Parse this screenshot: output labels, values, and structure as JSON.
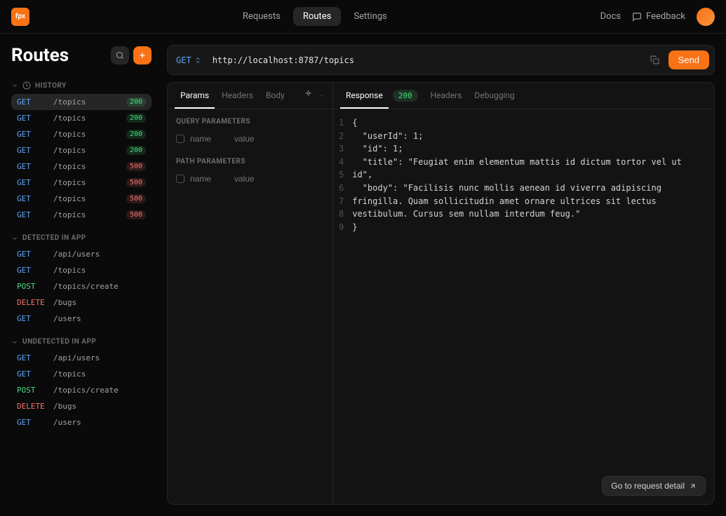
{
  "logo_text": "fpx",
  "nav": {
    "requests": "Requests",
    "routes": "Routes",
    "settings": "Settings",
    "docs": "Docs",
    "feedback": "Feedback"
  },
  "sidebar": {
    "title": "Routes",
    "sections": {
      "history": {
        "label": "HISTORY",
        "items": [
          {
            "method": "GET",
            "path": "/topics",
            "status": "200"
          },
          {
            "method": "GET",
            "path": "/topics",
            "status": "200"
          },
          {
            "method": "GET",
            "path": "/topics",
            "status": "200"
          },
          {
            "method": "GET",
            "path": "/topics",
            "status": "200"
          },
          {
            "method": "GET",
            "path": "/topics",
            "status": "500"
          },
          {
            "method": "GET",
            "path": "/topics",
            "status": "500"
          },
          {
            "method": "GET",
            "path": "/topics",
            "status": "500"
          },
          {
            "method": "GET",
            "path": "/topics",
            "status": "500"
          }
        ]
      },
      "detected": {
        "label": "DETECTED IN APP",
        "items": [
          {
            "method": "GET",
            "path": "/api/users"
          },
          {
            "method": "GET",
            "path": "/topics"
          },
          {
            "method": "POST",
            "path": "/topics/create"
          },
          {
            "method": "DELETE",
            "path": "/bugs"
          },
          {
            "method": "GET",
            "path": "/users"
          }
        ]
      },
      "undetected": {
        "label": "UNDETECTED IN APP",
        "items": [
          {
            "method": "GET",
            "path": "/api/users"
          },
          {
            "method": "GET",
            "path": "/topics"
          },
          {
            "method": "POST",
            "path": "/topics/create"
          },
          {
            "method": "DELETE",
            "path": "/bugs"
          },
          {
            "method": "GET",
            "path": "/users"
          }
        ]
      }
    }
  },
  "request": {
    "method": "GET",
    "url": "http://localhost:8787/topics",
    "send_label": "Send"
  },
  "left_panel": {
    "tabs": {
      "params": "Params",
      "headers": "Headers",
      "body": "Body"
    },
    "query_title": "QUERY PARAMETERS",
    "path_title": "PATH PARAMETERS",
    "name_placeholder": "name",
    "value_placeholder": "value"
  },
  "right_panel": {
    "tabs": {
      "response": "Response",
      "headers": "Headers",
      "debugging": "Debugging"
    },
    "status": "200"
  },
  "response_body": {
    "line1": "{",
    "line2": "  \"userId\": 1;",
    "line3": "  \"id\": 1;",
    "line4": "  \"title\": \"Feugiat enim elementum mattis id dictum tortor vel ut id\",",
    "line5": "  \"body\": \"Facilisis nunc mollis aenean id viverra adipiscing fringilla. Quam sollicitudin amet ornare ultrices sit lectus vestibulum. Cursus sem nullam interdum feug.\"",
    "line6": "}"
  },
  "line_numbers": [
    "1",
    "2",
    "3",
    "4",
    "5",
    "6",
    "7",
    "8",
    "9"
  ],
  "detail_button": "Go to request detail"
}
